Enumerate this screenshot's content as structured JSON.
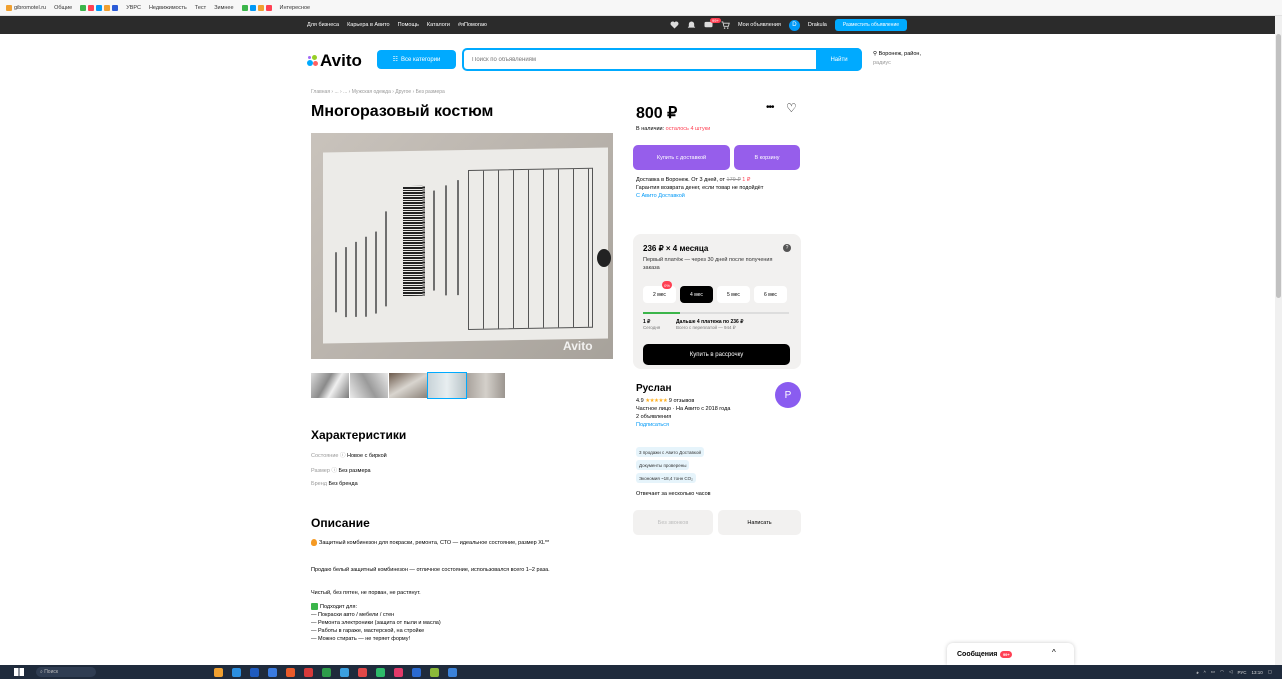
{
  "browser": {
    "bookmarks": [
      "gibromotel.ru",
      "Общие",
      "УВРС",
      "Недвижимость",
      "Тест",
      "Зимнее",
      "Интересное"
    ]
  },
  "topnav": {
    "links": [
      "Для бизнеса",
      "Карьера в Авито",
      "Помощь",
      "Каталоги",
      "#яПомогаю"
    ],
    "my_ads": "Мои объявления",
    "user_initial": "D",
    "user_name": "Drakula",
    "post_button": "Разместить объявление",
    "notif_badge": "99+"
  },
  "header": {
    "logo": "Avito",
    "categories_button": "Все категории",
    "search_placeholder": "Поиск по объявлениям",
    "search_button": "Найти",
    "location": "Воронеж, район,",
    "location_sub": "радиус"
  },
  "breadcrumb": "Главная › ... › ... › Мужская одежда › Другое › Без размера",
  "item": {
    "title": "Многоразовый костюм",
    "watermark": "Avito",
    "price": "800 ₽",
    "stock_prefix": "В наличии:",
    "stock_left": "осталось 4 штуки",
    "buy_delivery": "Купить с доставкой",
    "to_cart": "В корзину",
    "delivery_line1": "Доставка в Воронеж. От 3 дней, от",
    "delivery_old_price": "179 ₽",
    "delivery_new_price": "1 ₽",
    "delivery_line2": "Гарантия возврата денег, если товар не подойдёт",
    "delivery_link": "С Авито Доставкой"
  },
  "installment": {
    "title": "236 ₽ × 4 месяца",
    "info": "?",
    "subtitle": "Первый платёж — через 30 дней после получения заказа",
    "terms": [
      "2 мес",
      "4 мес",
      "5 мес",
      "6 мес"
    ],
    "active_term_index": 1,
    "hot_label": "0%",
    "progress": 0.25,
    "today_amount": "1 ₽",
    "today_label": "Сегодня",
    "rest_amount": "Дальше 4 платежа по 236 ₽",
    "rest_label": "Всего с переплатой — 944 ₽",
    "button": "Купить в рассрочку"
  },
  "seller": {
    "name": "Руслан",
    "initial": "P",
    "rating": "4.9",
    "stars": "★★★★★",
    "reviews": "9 отзывов",
    "type": "Частное лицо · На Авито с 2018 года",
    "ads_count": "2 объявления",
    "subscribe": "Подписаться",
    "badges": [
      "3 продажи с Авито Доставкой",
      "Документы проверены",
      "Экономия ~18,4 тонн CO₂"
    ],
    "reply_time": "Отвечает за несколько часов",
    "call_button": "Без звонков",
    "write_button": "Написать"
  },
  "characteristics": {
    "heading": "Характеристики",
    "rows": [
      {
        "key": "Состояние",
        "value": "Новое с биркой"
      },
      {
        "key": "Размер",
        "value": "Без размера"
      },
      {
        "key": "Бренд",
        "value": "Без бренда"
      }
    ]
  },
  "description": {
    "heading": "Описание",
    "p1": "Защитный комбинезон для покраски, ремонта, СТО — идеальное состояние, размер XL**",
    "p2": "Продаю белый защитный комбинезон — отличное состояние, использовался всего 1–2 раза.",
    "p3": "Чистый, без пятен, не порван, не растянут.",
    "list_title": "Подходит для:",
    "list": [
      "— Покраски авто / мебели / стен",
      "— Ремонта электроники (защита от пыли и масла)",
      "— Работы в гараже, мастерской, на стройке",
      "— Можно стирать — не теряет форму!"
    ]
  },
  "messages": {
    "label": "Сообщения",
    "badge": "99+",
    "chevron": "^"
  },
  "taskbar": {
    "search": "Поиск",
    "lang": "РУС",
    "time": "13:10"
  },
  "colors": {
    "accent": "#00aaff",
    "purple": "#965eeb",
    "red": "#ff4053",
    "green": "#3bb54a"
  }
}
